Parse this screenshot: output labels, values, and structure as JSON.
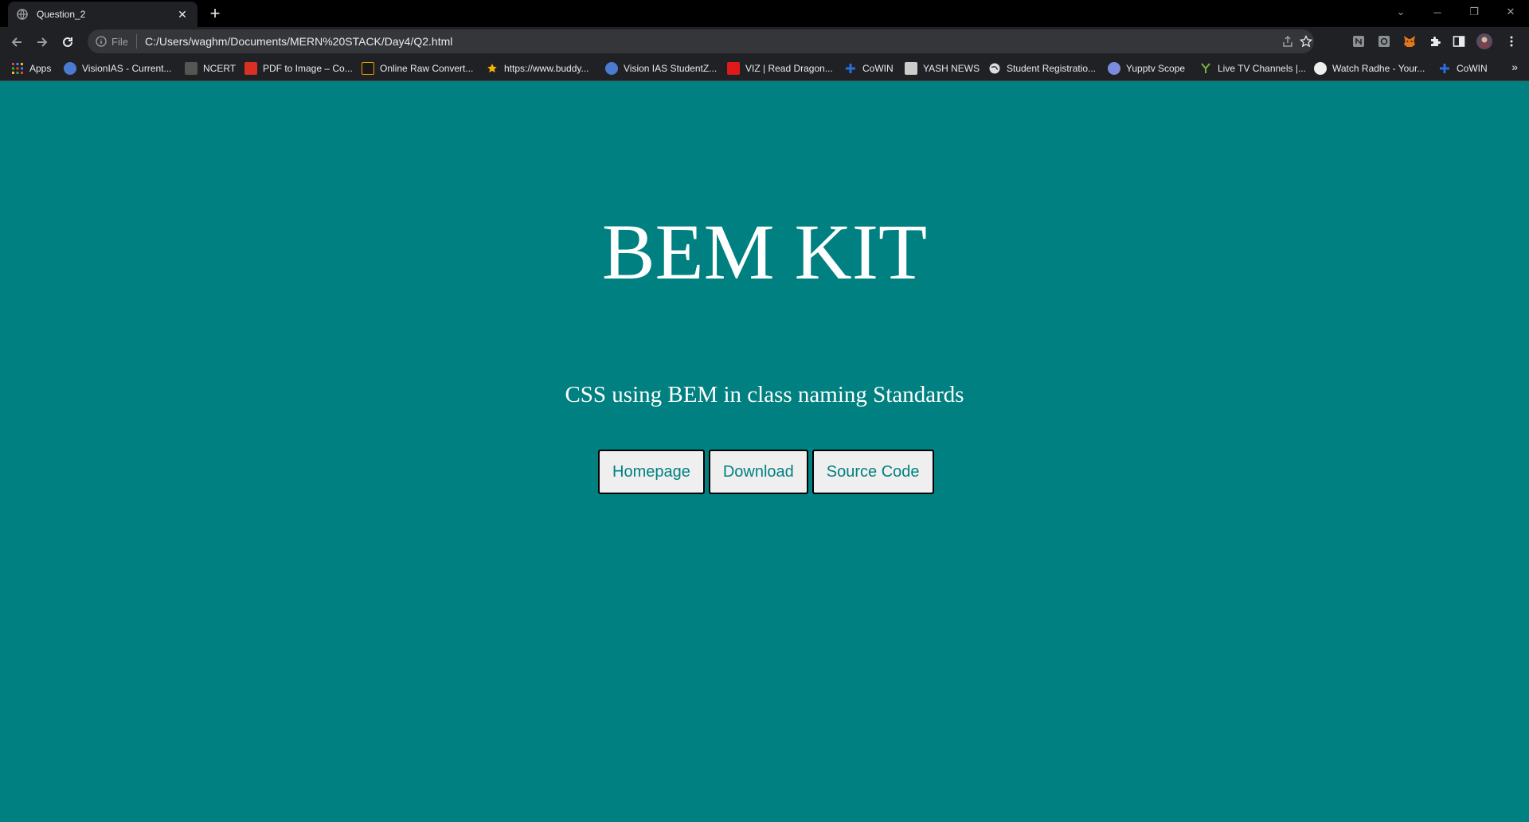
{
  "browser": {
    "tab": {
      "title": "Question_2",
      "close_glyph": "✕"
    },
    "newtab_glyph": "+",
    "window_controls": {
      "tabsearch": "⌄",
      "minimize": "─",
      "restore": "❐",
      "close": "✕"
    },
    "omnibox": {
      "scheme_label": "File",
      "url": "C:/Users/waghm/Documents/MERN%20STACK/Day4/Q2.html"
    },
    "bookmarks": [
      {
        "label": "Apps",
        "icon": "apps-grid-icon",
        "color": "#4285f4"
      },
      {
        "label": "VisionIAS - Current...",
        "icon": "visionias-icon",
        "color": "#4a7bd0"
      },
      {
        "label": "NCERT",
        "icon": "ncert-icon",
        "color": "#555555"
      },
      {
        "label": "PDF to Image – Co...",
        "icon": "pdf-icon",
        "color": "#d93025"
      },
      {
        "label": "Online Raw Convert...",
        "icon": "raw-convert-icon",
        "color": "#e8a000"
      },
      {
        "label": "https://www.buddy...",
        "icon": "star-icon",
        "color": "#f4b400"
      },
      {
        "label": "Vision IAS StudentZ...",
        "icon": "visionias-icon",
        "color": "#4a7bd0"
      },
      {
        "label": "VIZ | Read Dragon...",
        "icon": "viz-icon",
        "color": "#e01a1a"
      },
      {
        "label": "CoWIN",
        "icon": "cowin-icon",
        "color": "#2a6ede"
      },
      {
        "label": "YASH NEWS",
        "icon": "news-icon",
        "color": "#cccccc"
      },
      {
        "label": "Student Registratio...",
        "icon": "globe-icon",
        "color": "#dddddd"
      },
      {
        "label": "Yupptv Scope",
        "icon": "yupptv-icon",
        "color": "#7b8cde"
      },
      {
        "label": "Live TV Channels |...",
        "icon": "livetv-icon",
        "color": "#7cb342"
      },
      {
        "label": "Watch Radhe - Your...",
        "icon": "watch-icon",
        "color": "#eeeeee"
      },
      {
        "label": "CoWIN",
        "icon": "cowin-icon",
        "color": "#2a6ede"
      }
    ],
    "bookmarks_overflow": "»"
  },
  "page": {
    "background": "#008080",
    "title": "BEM KIT",
    "subtitle": "CSS using BEM in class naming Standards",
    "buttons": [
      {
        "label": "Homepage"
      },
      {
        "label": "Download"
      },
      {
        "label": "Source Code"
      }
    ]
  }
}
